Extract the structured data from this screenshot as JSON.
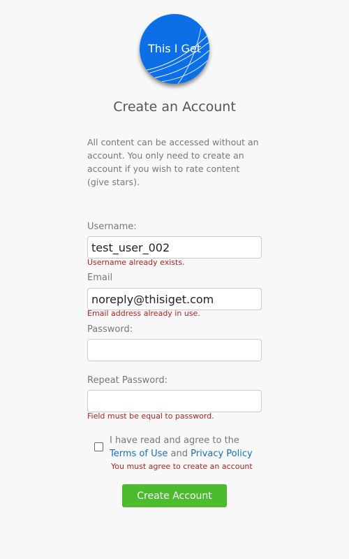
{
  "brand": {
    "logo_text": "This I Get",
    "logo_color": "#0c6fe8"
  },
  "page_title": "Create an Account",
  "intro": "All content can be accessed without an account. You only need to create an account if you wish to rate content (give stars).",
  "form": {
    "username": {
      "label": "Username:",
      "value": "test_user_002",
      "error": "Username already exists."
    },
    "email": {
      "label": "Email",
      "value": "noreply@thisiget.com",
      "error": "Email address already in use."
    },
    "password": {
      "label": "Password:",
      "value": ""
    },
    "repeat_password": {
      "label": "Repeat Password:",
      "value": "",
      "error": "Field must be equal to password."
    },
    "agree": {
      "checked": false,
      "text_before": "I have read and agree to the ",
      "terms_link": "Terms of Use",
      "text_middle": " and ",
      "privacy_link": "Privacy Policy",
      "error": "You must agree to create an account"
    },
    "submit_label": "Create Account"
  },
  "colors": {
    "error": "#b52020",
    "link": "#1a6fc2",
    "button": "#4cbb2e"
  }
}
